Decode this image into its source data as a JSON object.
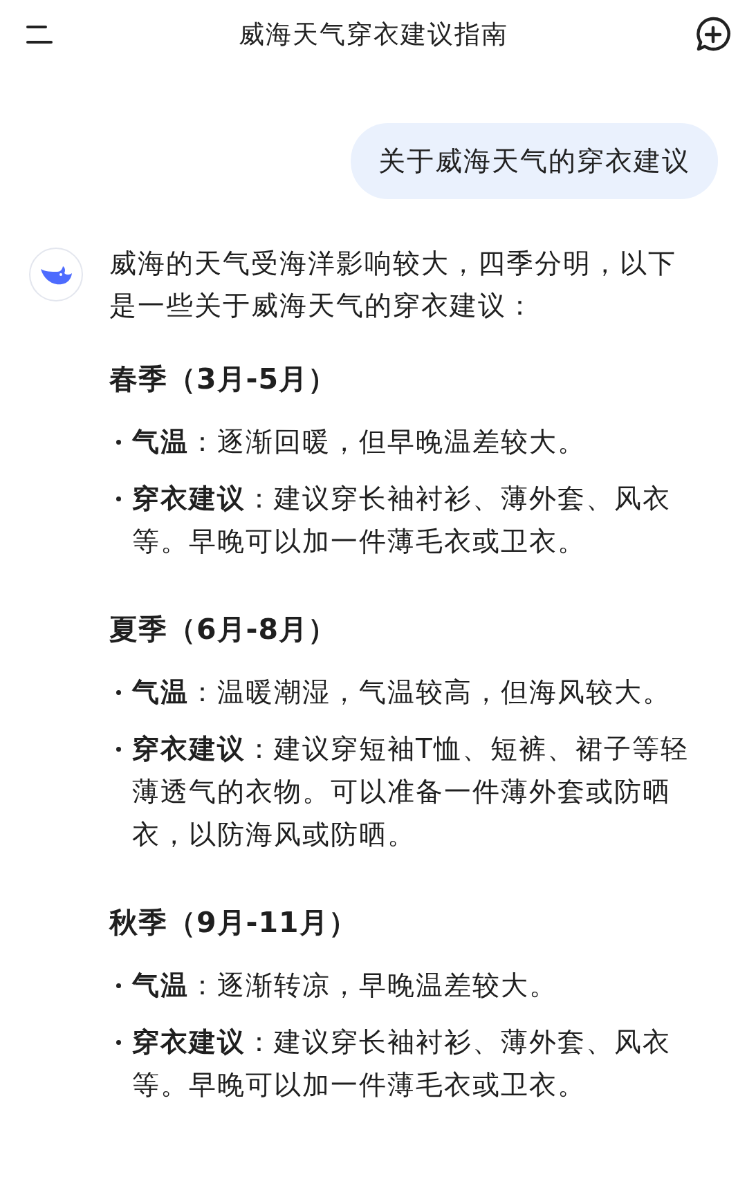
{
  "header": {
    "title": "威海天气穿衣建议指南"
  },
  "user_message": "关于威海天气的穿衣建议",
  "reply": {
    "intro": "威海的天气受海洋影响较大，四季分明，以下是一些关于威海天气的穿衣建议：",
    "sections": [
      {
        "heading": "春季（3月-5月）",
        "bullets": [
          "**气温**：逐渐回暖，但早晚温差较大。",
          "**穿衣建议**：建议穿长袖衬衫、薄外套、风衣等。早晚可以加一件薄毛衣或卫衣。"
        ]
      },
      {
        "heading": "夏季（6月-8月）",
        "bullets": [
          "**气温**：温暖潮湿，气温较高，但海风较大。",
          "**穿衣建议**：建议穿短袖T恤、短裤、裙子等轻薄透气的衣物。可以准备一件薄外套或防晒衣，以防海风或防晒。"
        ]
      },
      {
        "heading": "秋季（9月-11月）",
        "bullets": [
          "**气温**：逐渐转凉，早晚温差较大。",
          "**穿衣建议**：建议穿长袖衬衫、薄外套、风衣等。早晚可以加一件薄毛衣或卫衣。"
        ]
      }
    ]
  }
}
